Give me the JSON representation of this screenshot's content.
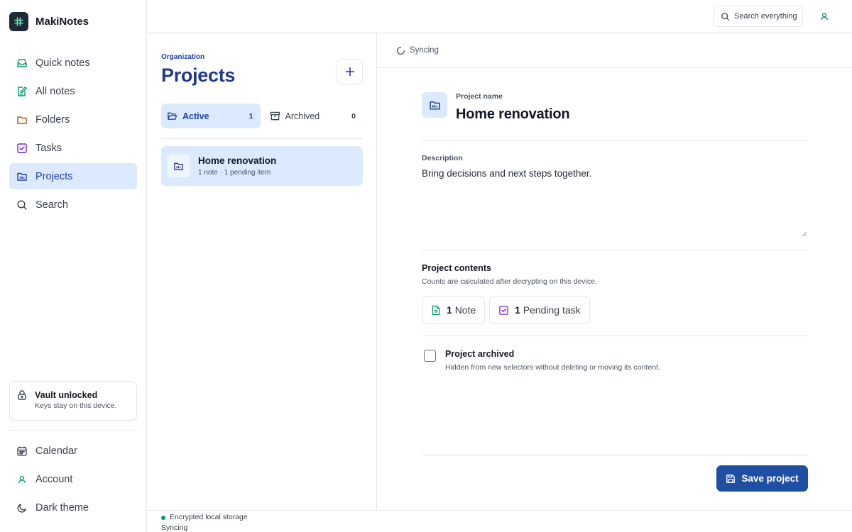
{
  "app": {
    "name": "MakiNotes"
  },
  "colors": {
    "accent": "#1e4fa3",
    "accent_light": "#dbeafe",
    "status_green": "#059669"
  },
  "sidebar": {
    "items": [
      {
        "label": "Quick notes",
        "icon": "inbox-icon"
      },
      {
        "label": "All notes",
        "icon": "note-edit-icon"
      },
      {
        "label": "Folders",
        "icon": "folder-icon"
      },
      {
        "label": "Tasks",
        "icon": "checkbox-icon"
      },
      {
        "label": "Projects",
        "icon": "project-folder-icon",
        "active": true
      },
      {
        "label": "Search",
        "icon": "search-icon"
      }
    ],
    "vault": {
      "title": "Vault unlocked",
      "subtitle": "Keys stay on this device."
    },
    "bottom_items": [
      {
        "label": "Calendar",
        "icon": "calendar-icon"
      },
      {
        "label": "Account",
        "icon": "user-icon"
      },
      {
        "label": "Dark theme",
        "icon": "moon-icon"
      }
    ]
  },
  "topbar": {
    "search_label": "Search everything"
  },
  "projects_list": {
    "org_label": "Organization",
    "title": "Projects",
    "tabs": [
      {
        "label": "Active",
        "count": "1",
        "active": true
      },
      {
        "label": "Archived",
        "count": "0",
        "active": false
      }
    ],
    "items": [
      {
        "title": "Home renovation",
        "subtitle": "1 note · 1 pending item"
      }
    ]
  },
  "detail": {
    "sync_status": "Syncing",
    "name_label": "Project name",
    "name_value": "Home renovation",
    "description_label": "Description",
    "description_value": "Bring decisions and next steps together.",
    "contents_title": "Project contents",
    "contents_subtitle": "Counts are calculated after decrypting on this device.",
    "note_count": "1",
    "note_label": "Note",
    "task_count": "1",
    "task_label": "Pending task",
    "archived_title": "Project archived",
    "archived_subtitle": "Hidden from new selectors without deleting or moving its content.",
    "archived_checked": false,
    "save_label": "Save project"
  },
  "statusbar": {
    "storage": "Encrypted local storage",
    "sync": "Syncing"
  }
}
